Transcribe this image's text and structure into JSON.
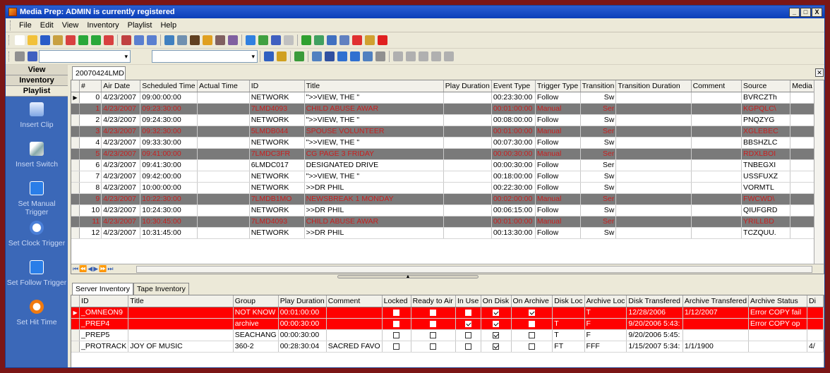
{
  "window": {
    "title": "Media Prep: ADMIN is currently registered",
    "min": "_",
    "max": "□",
    "close": "X"
  },
  "menu": [
    "File",
    "Edit",
    "View",
    "Inventory",
    "Playlist",
    "Help"
  ],
  "sidebar": {
    "headers": [
      "View",
      "Inventory",
      "Playlist"
    ],
    "buttons": [
      {
        "label": "Insert Clip",
        "icon": "insert-clip-icon"
      },
      {
        "label": "Insert Switch",
        "icon": "insert-switch-icon"
      },
      {
        "label": "Set Manual Trigger",
        "icon": "manual-trigger-icon"
      },
      {
        "label": "Set Clock Trigger",
        "icon": "clock-trigger-icon"
      },
      {
        "label": "Set Follow Trigger",
        "icon": "follow-trigger-icon"
      },
      {
        "label": "Set Hit Time",
        "icon": "hit-time-icon"
      }
    ]
  },
  "playlist_tab": "20070424LMD",
  "playlist": {
    "columns": [
      "#",
      "Air Date",
      "Scheduled Time",
      "Actual Time",
      "ID",
      "Title",
      "Play Duration",
      "Event Type",
      "Trigger Type",
      "Transition",
      "Transition Duration",
      "Comment",
      "Source",
      "Media T"
    ],
    "rows": [
      {
        "n": "0",
        "date": "4/23/2007",
        "sched": "09:00:00:00",
        "actual": "",
        "id": "NETWORK",
        "title": "\">>VIEW, THE      \"",
        "dur": "",
        "event": "00:23:30:00",
        "trigger": "Follow",
        "trans": "Sw",
        "tdur": "",
        "comment": "",
        "source": "BVRCZTh",
        "manual": false
      },
      {
        "n": "1",
        "date": "4/23/2007",
        "sched": "09:23:30:00",
        "actual": "",
        "id": "7LMD4093",
        "title": "CHILD ABUSE AWAR",
        "dur": "",
        "event": "00:01:00:00",
        "trigger": "Manual",
        "trans": "Ser",
        "tdur": "",
        "comment": "",
        "source": "KGPQLC\\",
        "manual": true
      },
      {
        "n": "2",
        "date": "4/23/2007",
        "sched": "09:24:30:00",
        "actual": "",
        "id": "NETWORK",
        "title": "\">>VIEW, THE      \"",
        "dur": "",
        "event": "00:08:00:00",
        "trigger": "Follow",
        "trans": "Sw",
        "tdur": "",
        "comment": "",
        "source": "PNQZYG",
        "manual": false
      },
      {
        "n": "3",
        "date": "4/23/2007",
        "sched": "09:32:30:00",
        "actual": "",
        "id": "5LMDB044",
        "title": "SPOUSE VOLUNTEER",
        "dur": "",
        "event": "00:01:00:00",
        "trigger": "Manual",
        "trans": "Ser",
        "tdur": "",
        "comment": "",
        "source": "XGLEBEC",
        "manual": true
      },
      {
        "n": "4",
        "date": "4/23/2007",
        "sched": "09:33:30:00",
        "actual": "",
        "id": "NETWORK",
        "title": "\">>VIEW, THE      \"",
        "dur": "",
        "event": "00:07:30:00",
        "trigger": "Follow",
        "trans": "Sw",
        "tdur": "",
        "comment": "",
        "source": "BBSHZLC",
        "manual": false
      },
      {
        "n": "5",
        "date": "4/23/2007",
        "sched": "09:41:00:00",
        "actual": "",
        "id": "7LMDC3FR",
        "title": "CG PAGE 3 FRIDAY",
        "dur": "",
        "event": "00:00:30:00",
        "trigger": "Manual",
        "trans": "Ser",
        "tdur": "",
        "comment": "",
        "source": "RDXLBOI",
        "manual": true
      },
      {
        "n": "6",
        "date": "4/23/2007",
        "sched": "09:41:30:00",
        "actual": "",
        "id": "6LMDC017",
        "title": "DESIGNATED DRIVE",
        "dur": "",
        "event": "00:00:30:00",
        "trigger": "Follow",
        "trans": "Ser",
        "tdur": "",
        "comment": "",
        "source": "TNBEGXI",
        "manual": false
      },
      {
        "n": "7",
        "date": "4/23/2007",
        "sched": "09:42:00:00",
        "actual": "",
        "id": "NETWORK",
        "title": "\">>VIEW, THE      \"",
        "dur": "",
        "event": "00:18:00:00",
        "trigger": "Follow",
        "trans": "Sw",
        "tdur": "",
        "comment": "",
        "source": "USSFUXZ",
        "manual": false
      },
      {
        "n": "8",
        "date": "4/23/2007",
        "sched": "10:00:00:00",
        "actual": "",
        "id": "NETWORK",
        "title": ">>DR PHIL",
        "dur": "",
        "event": "00:22:30:00",
        "trigger": "Follow",
        "trans": "Sw",
        "tdur": "",
        "comment": "",
        "source": "VORMTL",
        "manual": false
      },
      {
        "n": "9",
        "date": "4/23/2007",
        "sched": "10:22:30:00",
        "actual": "",
        "id": "7LMDB1MO",
        "title": "NEWSBREAK 1 MONDAY",
        "dur": "",
        "event": "00:02:00:00",
        "trigger": "Manual",
        "trans": "Ser",
        "tdur": "",
        "comment": "",
        "source": "FWCWD\\",
        "manual": true
      },
      {
        "n": "10",
        "date": "4/23/2007",
        "sched": "10:24:30:00",
        "actual": "",
        "id": "NETWORK",
        "title": ">>DR PHIL",
        "dur": "",
        "event": "00:06:15:00",
        "trigger": "Follow",
        "trans": "Sw",
        "tdur": "",
        "comment": "",
        "source": "QIUFGRD",
        "manual": false
      },
      {
        "n": "11",
        "date": "4/23/2007",
        "sched": "10:30:45:00",
        "actual": "",
        "id": "7LMD4093",
        "title": "CHILD ABUSE AWAR",
        "dur": "",
        "event": "00:01:00:00",
        "trigger": "Manual",
        "trans": "Ser",
        "tdur": "",
        "comment": "",
        "source": "YRILLBD",
        "manual": true
      },
      {
        "n": "12",
        "date": "4/23/2007",
        "sched": "10:31:45:00",
        "actual": "",
        "id": "NETWORK",
        "title": ">>DR PHIL",
        "dur": "",
        "event": "00:13:30:00",
        "trigger": "Follow",
        "trans": "Sw",
        "tdur": "",
        "comment": "",
        "source": "TCZQUU.",
        "manual": false
      }
    ]
  },
  "bottom_tabs": [
    "Server Inventory",
    "Tape Inventory"
  ],
  "inventory": {
    "columns": [
      "ID",
      "Title",
      "Group",
      "Play Duration",
      "Comment",
      "Locked",
      "Ready to Air",
      "In Use",
      "On Disk",
      "On Archive",
      "Disk Loc",
      "Archive Loc",
      "Disk Transfered",
      "Archive Transfered",
      "Archive Status",
      "Di"
    ],
    "rows": [
      {
        "id": "_OMNEON9",
        "title": "",
        "group": "NOT KNOW",
        "dur": "00:01:00:00",
        "comment": "",
        "locked": false,
        "ready": false,
        "inuse": false,
        "ondisk": true,
        "onarch": true,
        "dloc": "",
        "aloc": "T",
        "dtrans": "12/28/2006",
        "atrans": "1/12/2007",
        "astatus": "Error COPY fail",
        "di": "",
        "red": true,
        "current": true
      },
      {
        "id": "_PREP4",
        "title": "",
        "group": "archive",
        "dur": "00:00:30:00",
        "comment": "",
        "locked": false,
        "ready": false,
        "inuse": true,
        "ondisk": true,
        "onarch": false,
        "dloc": "T",
        "aloc": "F",
        "dtrans": "9/20/2006 5:43:",
        "atrans": "",
        "astatus": "Error COPY op",
        "di": "",
        "red": true,
        "current": false
      },
      {
        "id": "_PREP5",
        "title": "",
        "group": "SEACHANG",
        "dur": "00:00:30:00",
        "comment": "",
        "locked": false,
        "ready": false,
        "inuse": false,
        "ondisk": true,
        "onarch": false,
        "dloc": "T",
        "aloc": "F",
        "dtrans": "9/20/2006 5:45:",
        "atrans": "",
        "astatus": "",
        "di": "",
        "red": false,
        "current": false
      },
      {
        "id": "_PROTRACK",
        "title": "JOY OF MUSIC",
        "group": "360-2",
        "dur": "00:28:30:04",
        "comment": "SACRED FAVO",
        "locked": false,
        "ready": false,
        "inuse": false,
        "ondisk": true,
        "onarch": false,
        "dloc": "FT",
        "aloc": "FFF",
        "dtrans": "1/15/2007 5:34:",
        "atrans": "1/1/1900",
        "astatus": "",
        "di": "4/",
        "red": false,
        "current": false
      }
    ]
  },
  "colors": {
    "accent": "#3b68b8",
    "manual_row_bg": "#7a7a7a",
    "manual_text": "#c82020",
    "error_row": "#ff0000"
  }
}
